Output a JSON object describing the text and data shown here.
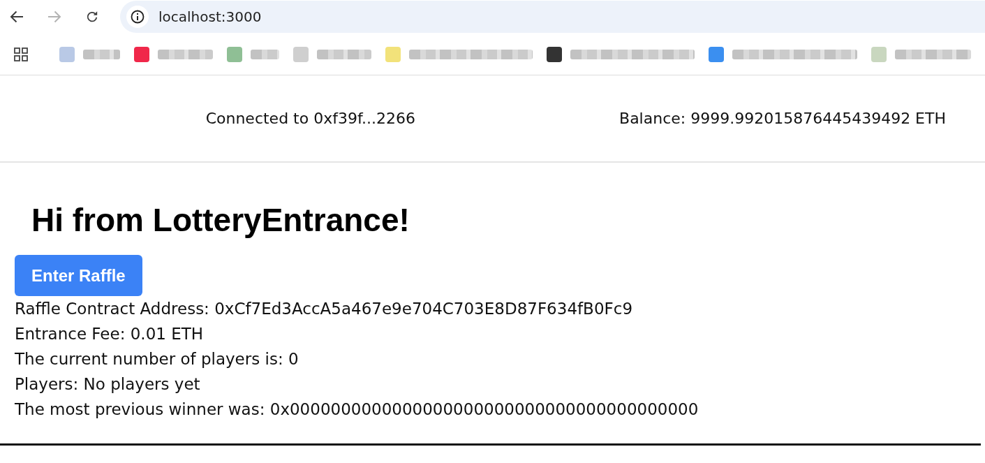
{
  "browser": {
    "nav_buttons": [
      {
        "kind": "back",
        "disabled": false
      },
      {
        "kind": "forward",
        "disabled": true
      },
      {
        "kind": "reload",
        "disabled": false
      }
    ],
    "url": "localhost:3000"
  },
  "bookmarks": [
    {
      "color": "#b9c9e6"
    },
    {
      "color": "#f0284a"
    },
    {
      "color": "#8fbf95"
    },
    {
      "color": "#cfcfcf"
    },
    {
      "color": "#f2e27a"
    },
    {
      "color": "#333333"
    },
    {
      "color": "#3b8ff0"
    },
    {
      "color": "#c9d7bf"
    }
  ],
  "header": {
    "account": "Connected to 0xf39f...2266",
    "balance": "Balance: 9999.992015876445439492 ETH"
  },
  "lottery": {
    "title": "Hi from LotteryEntrance!",
    "button": "Enter Raffle",
    "details": [
      "Raffle Contract Address: 0xCf7Ed3AccA5a467e9e704C703E8D87F634fB0Fc9",
      "Entrance Fee: 0.01 ETH",
      "The current number of players is: 0",
      "Players: No players yet",
      "The most previous winner was: 0x0000000000000000000000000000000000000000"
    ]
  }
}
